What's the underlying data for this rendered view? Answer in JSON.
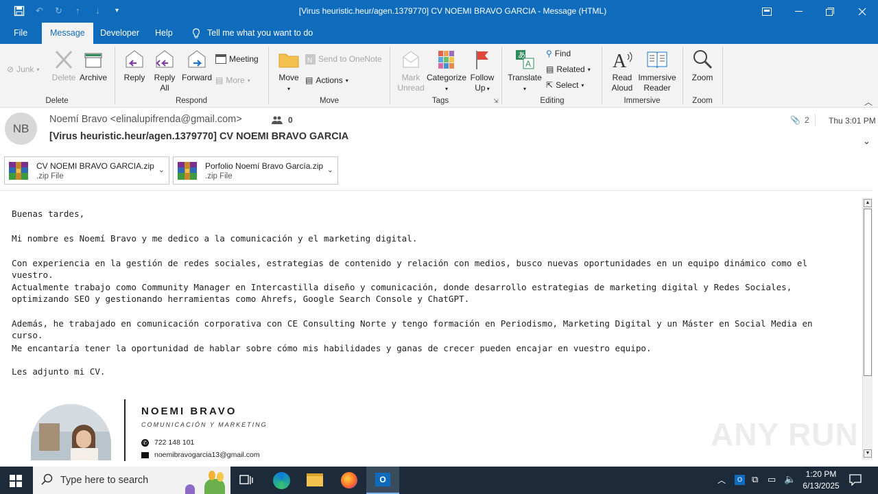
{
  "window": {
    "title": "[Virus heuristic.heur/agen.1379770] CV NOEMI BRAVO GARCIA  -  Message (HTML)"
  },
  "tabs": [
    "File",
    "Message",
    "Developer",
    "Help"
  ],
  "tell_me": "Tell me what you want to do",
  "ribbon": {
    "junk": "Junk",
    "delete": "Delete",
    "archive": "Archive",
    "reply": "Reply",
    "reply_all_1": "Reply",
    "reply_all_2": "All",
    "forward": "Forward",
    "meeting": "Meeting",
    "more": "More",
    "move": "Move",
    "send_onenote": "Send to OneNote",
    "actions": "Actions",
    "mark_unread_1": "Mark",
    "mark_unread_2": "Unread",
    "categorize": "Categorize",
    "follow_up_1": "Follow",
    "follow_up_2": "Up",
    "translate": "Translate",
    "find": "Find",
    "related": "Related",
    "select": "Select",
    "read_aloud_1": "Read",
    "read_aloud_2": "Aloud",
    "immersive_1": "Immersive",
    "immersive_2": "Reader",
    "zoom": "Zoom",
    "groups": {
      "delete": "Delete",
      "respond": "Respond",
      "move": "Move",
      "tags": "Tags",
      "editing": "Editing",
      "immersive": "Immersive",
      "zoom": "Zoom"
    }
  },
  "message": {
    "avatar_initials": "NB",
    "from": "Noemí Bravo <elinalupifrenda@gmail.com>",
    "people_count": "0",
    "subject": "[Virus heuristic.heur/agen.1379770] CV NOEMI BRAVO GARCIA",
    "attachment_count": "2",
    "date": "Thu 3:01 PM"
  },
  "attachments": [
    {
      "name": "CV NOEMI BRAVO GARCIA.zip",
      "type": ".zip File"
    },
    {
      "name": "Porfolio Noemí Bravo García.zip",
      "type": ".zip File"
    }
  ],
  "body": {
    "p1": "Buenas tardes,",
    "p2": "Mi nombre es Noemí Bravo y me dedico a la comunicación y el marketing digital.",
    "p3": "Con experiencia en la gestión de redes sociales, estrategias de contenido y relación con medios, busco nuevas oportunidades en un equipo dinámico como el vuestro.",
    "p4": "Actualmente trabajo como Community Manager en Intercastilla diseño y comunicación, donde desarrollo estrategias de marketing digital y Redes Sociales, optimizando SEO y gestionando herramientas como Ahrefs, Google Search Console y ChatGPT.",
    "p5": "Además, he trabajado en comunicación corporativa con CE Consulting Norte y tengo formación en Periodismo, Marketing Digital y un Máster en Social Media en curso.",
    "p6": "Me encantaría tener la oportunidad de hablar sobre cómo mis habilidades y ganas de crecer pueden encajar en vuestro equipo.",
    "p7": "Les adjunto mi CV."
  },
  "signature": {
    "name": "NOEMI BRAVO",
    "role": "COMUNICACIÓN Y MARKETING",
    "phone": "722 148 101",
    "email": "noemibravogarcia13@gmail.com"
  },
  "watermark": "ANY RUN",
  "taskbar": {
    "search_placeholder": "Type here to search",
    "time": "1:20 PM",
    "date": "6/13/2025"
  },
  "colors": {
    "accent": "#0f6cbd",
    "taskbar": "#1c2a3a"
  }
}
